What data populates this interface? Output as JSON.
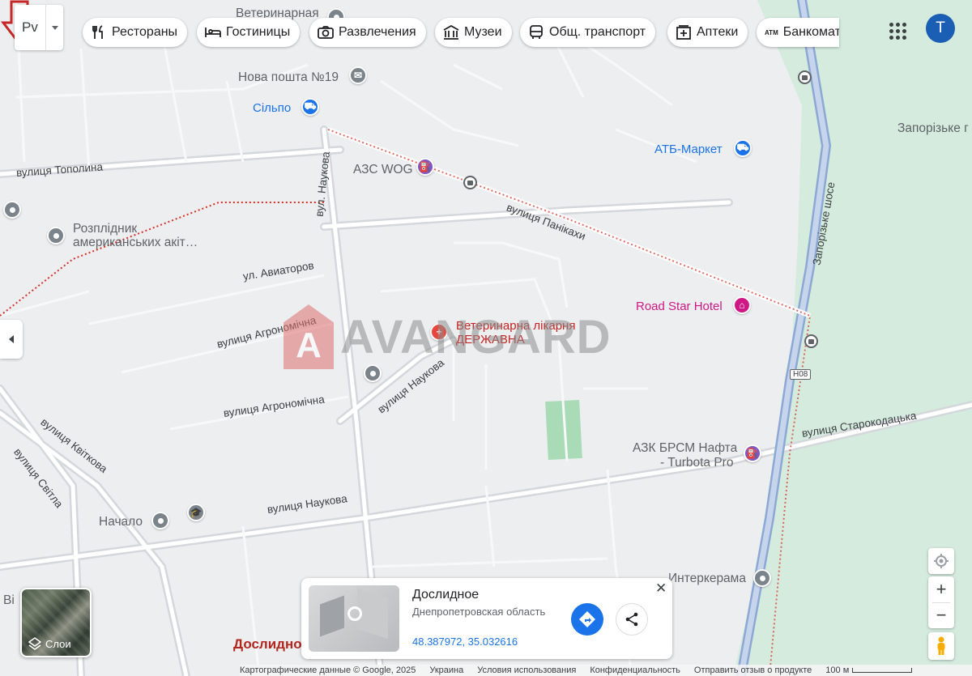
{
  "map_type": "street",
  "colors": {
    "background": "#eceef0",
    "green_area": "#d4ebdd",
    "highway": "#8ca8d4",
    "boundary": "#d93025",
    "poi_blue": "#1a73e8",
    "poi_pink": "#d01884"
  },
  "top_bar": {
    "language_code": "Рv",
    "chips": [
      {
        "label": "Рестораны",
        "icon": "fork-knife-icon"
      },
      {
        "label": "Гостиницы",
        "icon": "bed-icon"
      },
      {
        "label": "Развлечения",
        "icon": "camera-icon"
      },
      {
        "label": "Музеи",
        "icon": "museum-icon"
      },
      {
        "label": "Общ. транспорт",
        "icon": "bus-icon"
      },
      {
        "label": "Аптеки",
        "icon": "pharmacy-icon"
      },
      {
        "label": "Банкоматы",
        "icon": "atm-icon",
        "icon_text": "ATM"
      }
    ],
    "avatar_letter": "T"
  },
  "map_labels": {
    "vet_top": "Ветеринарная",
    "nova_poshta": "Нова пошта №19",
    "silpo": "Сільпо",
    "topolina": "вулиця Тополина",
    "naukova_vert": "вул. Наукова",
    "azs_wog": "АЗС WOG",
    "atb": "АТБ-Маркет",
    "zaporizke_park": "Запорізьке г",
    "panikakhy": "вулиця Панікахи",
    "zaporizke_shose": "Запорізьке шосе",
    "rozplidnyk": "Розплідник американських акіт…",
    "aviatorov": "ул. Авиаторов",
    "road_star": "Road Star Hotel",
    "vet_hospital_1": "Ветеринарна лікарня",
    "vet_hospital_2": "ДЕРЖАВНА",
    "agronomichna_1": "вулиця Агрономічна",
    "agronomichna_2": "вулиця Агрономічна",
    "naukova_diag": "вулиця Наукова",
    "n08": "Н08",
    "starokodatska": "вулиця Старокодацька",
    "kvitkova": "вулиця Квіткова",
    "svitla": "вулиця Світла",
    "azk_brsm_1": "АЗК БРСМ Нафта",
    "azk_brsm_2": "- Turbota Pro",
    "nachalo": "Начало",
    "naukova_main": "вулиця Наукова",
    "interkerama": "Интеркерама",
    "vi_partial": "Ві",
    "doslidnoe_map": "Дослидно"
  },
  "watermark": {
    "logo_letter": "A",
    "text": "AVANGARD"
  },
  "place_card": {
    "name": "Дослидное",
    "region": "Днепропетровская область",
    "coordinates": "48.387972, 35.032616"
  },
  "layers": {
    "label": "Слои"
  },
  "footer": {
    "attribution": "Картографические данные © Google, 2025",
    "country": "Украина",
    "terms": "Условия использования",
    "privacy": "Конфиденциальность",
    "feedback": "Отправить отзыв о продукте",
    "scale": "100 м"
  }
}
